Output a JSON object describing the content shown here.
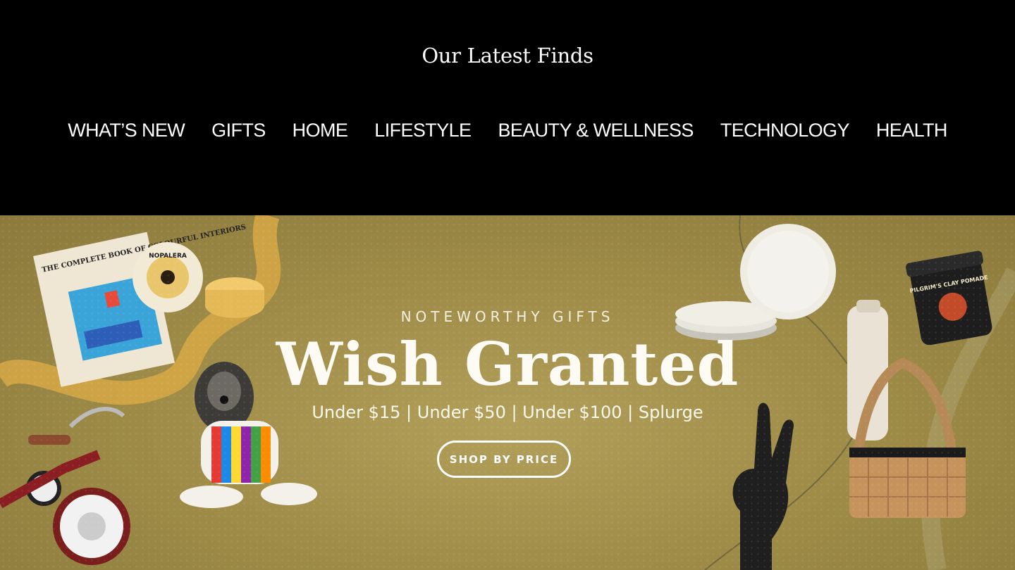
{
  "header": {
    "title": "Our Latest Finds",
    "nav": [
      {
        "label": "WHAT’S NEW"
      },
      {
        "label": "GIFTS"
      },
      {
        "label": "HOME"
      },
      {
        "label": "LIFESTYLE"
      },
      {
        "label": "BEAUTY & WELLNESS"
      },
      {
        "label": "TECHNOLOGY"
      },
      {
        "label": "HEALTH"
      }
    ]
  },
  "hero": {
    "eyebrow": "NOTEWORTHY GIFTS",
    "headline": "Wish Granted",
    "price_links": "Under $15 | Under $50 | Under $100 | Splurge",
    "cta": "SHOP BY PRICE",
    "book_title": "THE COMPLETE BOOK OF COLOURFUL INTERIORS",
    "badge_text": "NOPALERA",
    "jar_label": "PILGRIM'S CLAY POMADE",
    "colors": {
      "background": "#a08d49",
      "text": "#fdfbf3"
    }
  }
}
